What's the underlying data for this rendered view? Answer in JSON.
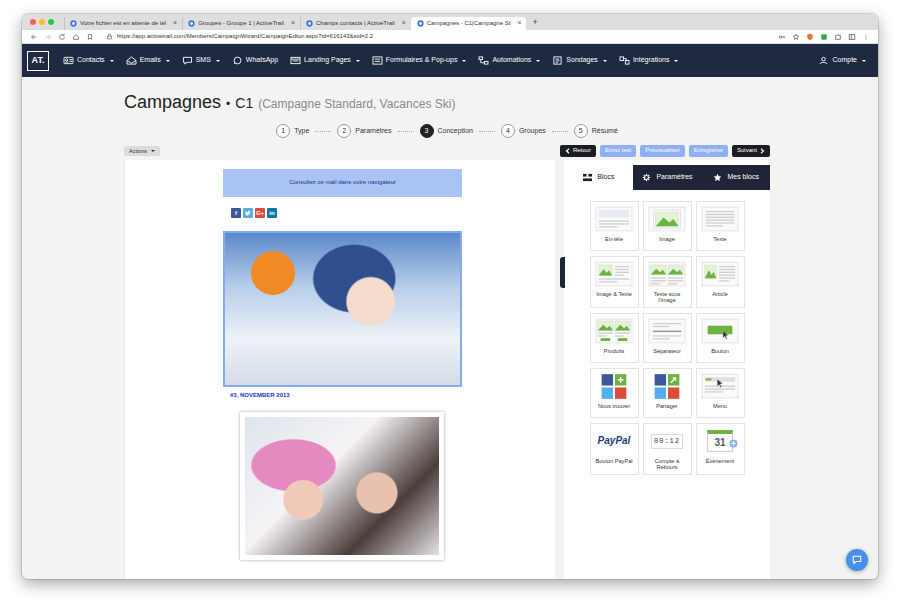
{
  "browser": {
    "tabs": [
      {
        "label": "Votre fichier est en attente de tél",
        "selected": false
      },
      {
        "label": "Groupes - Groupe 1 | ActiveTrail",
        "selected": false
      },
      {
        "label": "Champs contacts | ActiveTrail",
        "selected": false
      },
      {
        "label": "Campagnes - C1|Campagne St",
        "selected": true
      }
    ],
    "tab_close": "×",
    "new_tab": "+",
    "url": "https://app.activetrail.com/Members/CampaignWizard/CampaignEditor.aspx?id=616143&sid=2.2"
  },
  "navbar": {
    "logo": "AT.",
    "items": [
      {
        "label": "Contacts",
        "dropdown": true
      },
      {
        "label": "Emails",
        "dropdown": true
      },
      {
        "label": "SMS",
        "dropdown": true
      },
      {
        "label": "WhatsApp",
        "dropdown": false
      },
      {
        "label": "Landing Pages",
        "dropdown": true
      },
      {
        "label": "Formulaires & Pop-ups",
        "dropdown": true
      },
      {
        "label": "Automations",
        "dropdown": true
      },
      {
        "label": "Sondages",
        "dropdown": true
      },
      {
        "label": "Intégrations",
        "dropdown": true
      }
    ],
    "account": {
      "label": "Compte",
      "dropdown": true
    }
  },
  "header": {
    "title": "Campagnes",
    "separator": "•",
    "campaign": "C1",
    "subtitle": "(Campagne Standard, Vacances Ski)"
  },
  "steps": [
    {
      "number": "1",
      "label": "Type",
      "selected": false
    },
    {
      "number": "2",
      "label": "Paramètres",
      "selected": false
    },
    {
      "number": "3",
      "label": "Conception",
      "selected": true
    },
    {
      "number": "4",
      "label": "Groupes",
      "selected": false
    },
    {
      "number": "5",
      "label": "Résumé",
      "selected": false
    }
  ],
  "actions_button": {
    "label": "Actions",
    "dropdown": true
  },
  "toolbar": [
    {
      "label": "Retour",
      "kind": "back"
    },
    {
      "label": "Envoi test",
      "kind": "light"
    },
    {
      "label": "Prévisualiser",
      "kind": "light"
    },
    {
      "label": "Enregistrer",
      "kind": "light"
    },
    {
      "label": "Suivant",
      "kind": "next"
    }
  ],
  "email": {
    "browser_link": "Consultez ce mail dans votre navigateur",
    "social": [
      {
        "kind": "facebook",
        "glyph": "f",
        "color": "#3b5998"
      },
      {
        "kind": "twitter",
        "color": "#55acee"
      },
      {
        "kind": "google",
        "glyph": "G+",
        "color": "#dd4b39"
      },
      {
        "kind": "linkedin",
        "glyph": "in",
        "color": "#0e76a8"
      }
    ],
    "hero_selected": true,
    "issue": "#3, NOVEMBER 2013"
  },
  "panel": {
    "tabs": [
      {
        "label": "Blocs",
        "selected": true
      },
      {
        "label": "Paramètres",
        "selected": false
      },
      {
        "label": "Mes blocs",
        "selected": false
      }
    ],
    "blocks": [
      {
        "label": "En-tête",
        "kind": "header"
      },
      {
        "label": "Image",
        "kind": "image"
      },
      {
        "label": "Texte",
        "kind": "text"
      },
      {
        "label": "Image & Texte",
        "kind": "image-text"
      },
      {
        "label": "Texte sous l'image",
        "kind": "text-under-image"
      },
      {
        "label": "Article",
        "kind": "article"
      },
      {
        "label": "Produits",
        "kind": "products"
      },
      {
        "label": "Séparateur",
        "kind": "separator"
      },
      {
        "label": "Bouton",
        "kind": "button"
      },
      {
        "label": "Nous trouver",
        "kind": "social-find"
      },
      {
        "label": "Partager",
        "kind": "share"
      },
      {
        "label": "Menu",
        "kind": "menu"
      },
      {
        "label": "Bouton PayPal",
        "kind": "paypal",
        "icon_text": "PayPal"
      },
      {
        "label": "Compte à Rebours",
        "kind": "countdown",
        "icon_text": "00:12"
      },
      {
        "label": "Événement",
        "kind": "event",
        "icon_text": "31"
      }
    ]
  }
}
